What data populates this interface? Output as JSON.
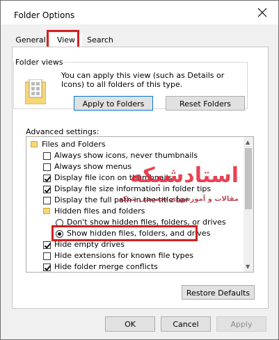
{
  "window": {
    "title": "Folder Options"
  },
  "tabs": [
    "General",
    "View",
    "Search"
  ],
  "folder_views": {
    "legend": "Folder views",
    "text": "You can apply this view (such as Details or Icons) to all folders of this type.",
    "apply_button": "Apply to Folders",
    "reset_button": "Reset Folders"
  },
  "advanced": {
    "label": "Advanced settings:",
    "items": [
      {
        "kind": "folder",
        "label": "Files and Folders"
      },
      {
        "kind": "checkbox",
        "checked": false,
        "label": "Always show icons, never thumbnails"
      },
      {
        "kind": "checkbox",
        "checked": false,
        "label": "Always show menus"
      },
      {
        "kind": "checkbox",
        "checked": true,
        "label": "Display file icon on thumbnails"
      },
      {
        "kind": "checkbox",
        "checked": true,
        "label": "Display file size information in folder tips"
      },
      {
        "kind": "checkbox",
        "checked": false,
        "label": "Display the full path in the title bar"
      },
      {
        "kind": "folder",
        "label": "Hidden files and folders"
      },
      {
        "kind": "radio",
        "checked": false,
        "label": "Don't show hidden files, folders, or drives"
      },
      {
        "kind": "radio",
        "checked": true,
        "label": "Show hidden files, folders, and drives"
      },
      {
        "kind": "checkbox",
        "checked": true,
        "label": "Hide empty drives"
      },
      {
        "kind": "checkbox",
        "checked": false,
        "label": "Hide extensions for known file types"
      },
      {
        "kind": "checkbox",
        "checked": true,
        "label": "Hide folder merge conflicts"
      }
    ]
  },
  "buttons": {
    "restore": "Restore Defaults",
    "ok": "OK",
    "cancel": "Cancel",
    "apply": "Apply"
  },
  "watermark": {
    "brand": "استادشبکه",
    "tagline": "مقالات و آموزشهای تخصصی شبکه"
  },
  "colors": {
    "highlight": "#d21f1f",
    "accent": "#0078d7"
  }
}
